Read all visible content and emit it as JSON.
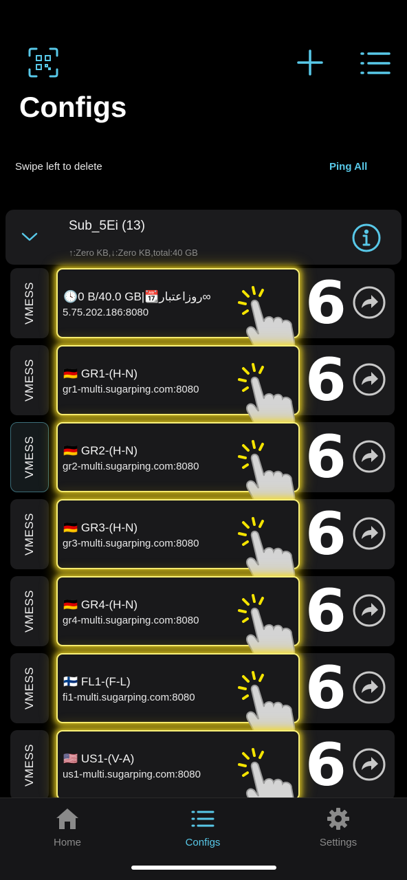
{
  "header": {
    "title": "Configs",
    "swipe_hint": "Swipe left to delete",
    "ping_all": "Ping All"
  },
  "subscription": {
    "name": "Sub_5Ei (13)",
    "stats": "↑:Zero KB,↓:Zero KB,total:40 GB"
  },
  "configs": [
    {
      "type": "VMESS",
      "name": "🕓0 B/40.0 GB|📆روزاعتبار∞",
      "address": "5.75.202.186:8080",
      "ping": "6",
      "selected": false
    },
    {
      "type": "VMESS",
      "name": "🇩🇪 GR1-(H-N)",
      "address": "gr1-multi.sugarping.com:8080",
      "ping": "6",
      "selected": false
    },
    {
      "type": "VMESS",
      "name": "🇩🇪 GR2-(H-N)",
      "address": "gr2-multi.sugarping.com:8080",
      "ping": "6",
      "selected": true
    },
    {
      "type": "VMESS",
      "name": "🇩🇪 GR3-(H-N)",
      "address": "gr3-multi.sugarping.com:8080",
      "ping": "6",
      "selected": false
    },
    {
      "type": "VMESS",
      "name": "🇩🇪 GR4-(H-N)",
      "address": "gr4-multi.sugarping.com:8080",
      "ping": "6",
      "selected": false
    },
    {
      "type": "VMESS",
      "name": "🇫🇮 FL1-(F-L)",
      "address": "fi1-multi.sugarping.com:8080",
      "ping": "6",
      "selected": false
    },
    {
      "type": "VMESS",
      "name": "🇺🇸 US1-(V-A)",
      "address": "us1-multi.sugarping.com:8080",
      "ping": "6",
      "selected": false
    }
  ],
  "nav": {
    "home": "Home",
    "configs": "Configs",
    "settings": "Settings"
  },
  "colors": {
    "accent": "#58c8e8",
    "highlight": "#f8f07a",
    "background": "#000000",
    "card": "#1b1b1d"
  }
}
